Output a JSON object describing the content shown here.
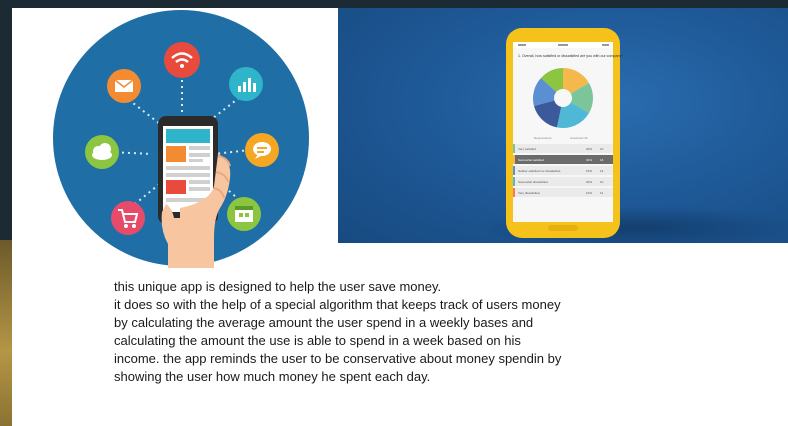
{
  "description": {
    "lines": [
      "this unique app is designed to help the user save money.",
      "it does so with the help of a special algorithm that keeps track of users money",
      "by calculating the average amount the user spend in a weekly bases and",
      "calculating the amount the use is able to spend in a week based on his",
      "income. the app reminds the user to be conservative about money spendin by",
      "showing the user how much money he spent each day."
    ]
  },
  "phone_screen": {
    "question": "1. Overall, how satisfied or dissatisfied are you with our company?",
    "legend": [
      "Respondents",
      "Answered 46"
    ],
    "rows": [
      {
        "label": "Very satisfied",
        "pct": "20%",
        "n": "10"
      },
      {
        "label": "Somewhat satisfied",
        "pct": "34%",
        "n": "16"
      },
      {
        "label": "Neither satisfied nor dissatisfied",
        "pct": "15%",
        "n": "14"
      },
      {
        "label": "Somewhat dissatisfied",
        "pct": "20%",
        "n": "10"
      },
      {
        "label": "Very dissatisfied",
        "pct": "10%",
        "n": "11"
      }
    ],
    "pie_colors": [
      "#f4b94a",
      "#7cc49a",
      "#5a8fd1",
      "#3a5a9c",
      "#f07a5a",
      "#4fb8d6"
    ]
  },
  "colors": {
    "background_dark": "#1b2a33",
    "circle_blue": "#1f6fa6",
    "photo_blue": "#1f5a99",
    "phone_yellow": "#f5c21b"
  }
}
